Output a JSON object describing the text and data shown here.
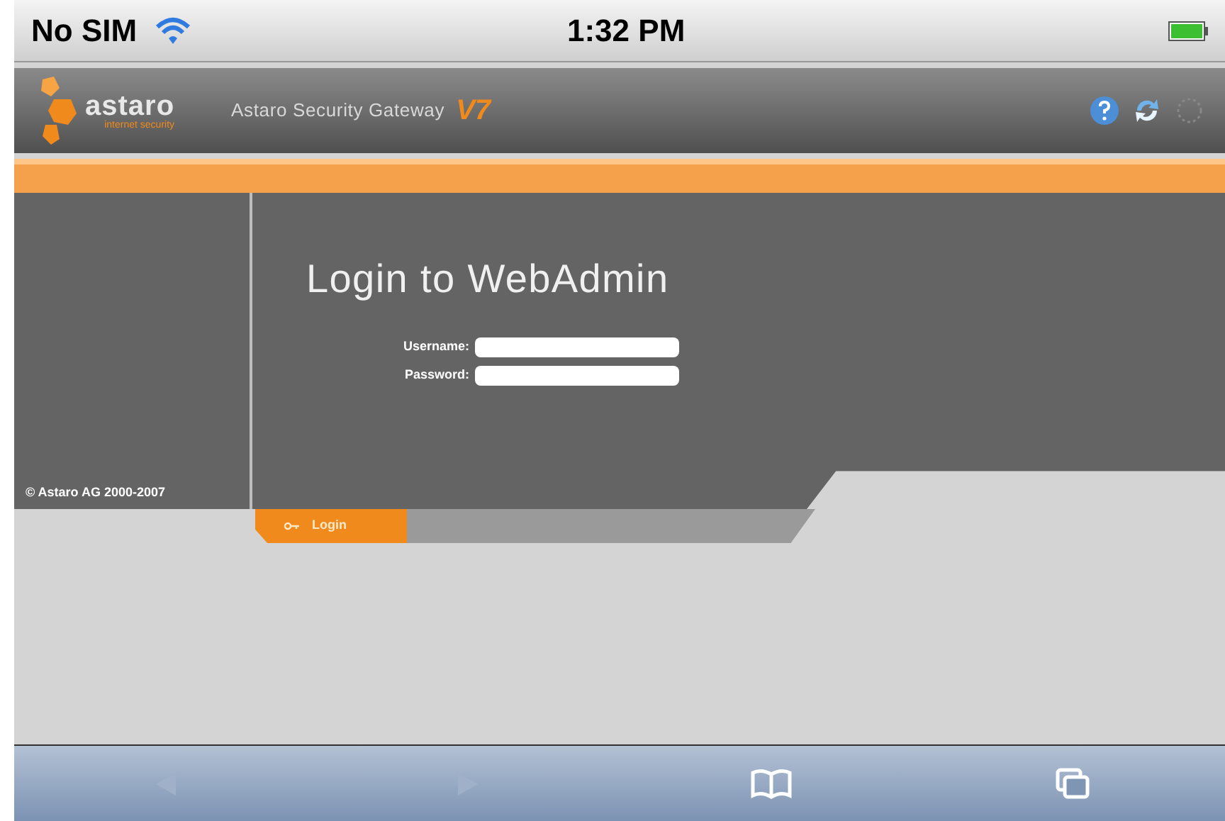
{
  "status_bar": {
    "carrier": "No SIM",
    "time": "1:32 PM"
  },
  "header": {
    "logo_name": "astaro",
    "logo_tagline": "internet security",
    "product": "Astaro Security Gateway",
    "version": "V7"
  },
  "sidebar": {
    "copyright": "© Astaro AG 2000-2007"
  },
  "login": {
    "title": "Login to WebAdmin",
    "fields": [
      {
        "label": "Username:"
      },
      {
        "label": "Password:"
      }
    ],
    "button": "Login"
  },
  "toolbar": {
    "items": [
      {
        "kind": "back",
        "disabled": true
      },
      {
        "kind": "forward",
        "disabled": true
      },
      {
        "kind": "bookmarks",
        "disabled": false
      },
      {
        "kind": "pages",
        "disabled": false
      }
    ]
  }
}
